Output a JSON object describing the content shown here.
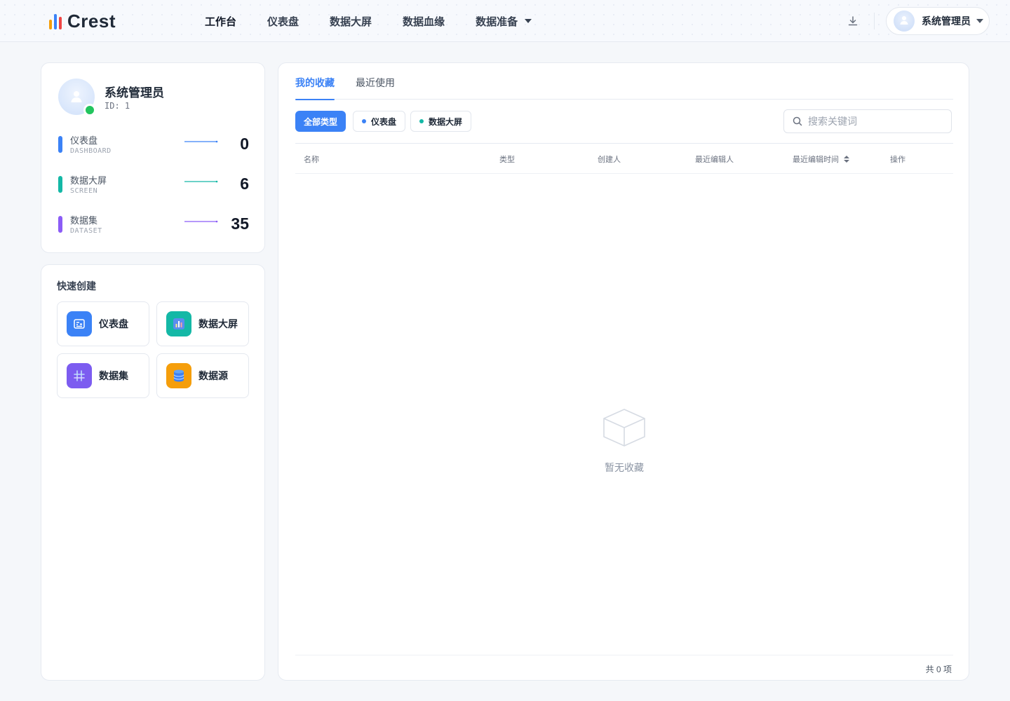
{
  "header": {
    "logo_text": "Crest",
    "logo_colors": [
      "#f59e0b",
      "#3b82f6",
      "#ef4444"
    ],
    "nav": [
      {
        "label": "工作台",
        "active": true
      },
      {
        "label": "仪表盘"
      },
      {
        "label": "数据大屏"
      },
      {
        "label": "数据血缘"
      },
      {
        "label": "数据准备",
        "has_dropdown": true
      }
    ],
    "download_icon": "download-icon",
    "user_name": "系统管理员"
  },
  "profile": {
    "name": "系统管理员",
    "id_text": "ID: 1",
    "status": "online",
    "stats": [
      {
        "label": "仪表盘",
        "sub": "DASHBOARD",
        "value": "0",
        "color": "#3b82f6"
      },
      {
        "label": "数据大屏",
        "sub": "SCREEN",
        "value": "6",
        "color": "#14b8a6"
      },
      {
        "label": "数据集",
        "sub": "DATASET",
        "value": "35",
        "color": "#8b5cf6"
      }
    ]
  },
  "quick_create": {
    "title": "快速创建",
    "items": [
      {
        "label": "仪表盘",
        "icon": "dashboard-icon",
        "color": "#3b82f6"
      },
      {
        "label": "数据大屏",
        "icon": "screen-chart-icon",
        "color": "#14b8a6"
      },
      {
        "label": "数据集",
        "icon": "dataset-grid-icon",
        "color": "#7c5cf0"
      },
      {
        "label": "数据源",
        "icon": "database-icon",
        "color": "#f59e0b"
      }
    ]
  },
  "main": {
    "tabs": [
      {
        "label": "我的收藏",
        "active": true
      },
      {
        "label": "最近使用"
      }
    ],
    "filters": [
      {
        "label": "全部类型",
        "active": true
      },
      {
        "label": "仪表盘",
        "dot_color": "#3b82f6"
      },
      {
        "label": "数据大屏",
        "dot_color": "#14b8a6"
      }
    ],
    "search_placeholder": "搜索关键词",
    "table_headers": [
      "名称",
      "类型",
      "创建人",
      "最近编辑人",
      "最近编辑时间",
      "操作"
    ],
    "rows": [],
    "empty_text": "暂无收藏",
    "total_text": "共 0 项"
  },
  "accent_color": "#3b82f6"
}
